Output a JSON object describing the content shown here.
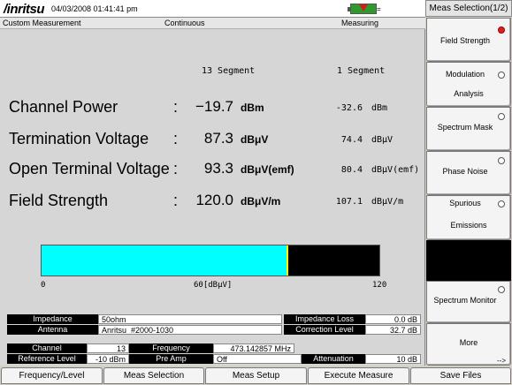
{
  "header": {
    "brand": "/inritsu",
    "datetime": "04/03/2008 01:41:41 pm",
    "battery_suffix": "="
  },
  "status": {
    "mode": "Custom Measurement",
    "sweep": "Continuous",
    "state": "Measuring"
  },
  "segments": {
    "multi": "13 Segment",
    "single": "1 Segment"
  },
  "measurements": [
    {
      "label": "Channel Power",
      "colon": ":",
      "value": "−19.7",
      "unit": "dBm",
      "single_value": "-32.6",
      "single_unit": "dBm"
    },
    {
      "label": "Termination Voltage",
      "colon": ":",
      "value": "87.3",
      "unit": "dBμV",
      "single_value": "74.4",
      "single_unit": "dBμV"
    },
    {
      "label": "Open Terminal Voltage",
      "colon": ":",
      "value": "93.3",
      "unit": "dBμV(emf)",
      "single_value": "80.4",
      "single_unit": "dBμV(emf)"
    },
    {
      "label": "Field Strength",
      "colon": ":",
      "value": "120.0",
      "unit": "dBμV/m",
      "single_value": "107.1",
      "single_unit": "dBμV/m"
    }
  ],
  "bar": {
    "min_label": "0",
    "mid_label": "60[dBμV]",
    "max_label": "120",
    "min": 0,
    "max": 120,
    "value": 87.3,
    "fill_color": "#00ffff",
    "marker_color": "#ffff00"
  },
  "info": {
    "impedance_label": "Impedance",
    "impedance_value": "50ohm",
    "impedance_loss_label": "Impedance Loss",
    "impedance_loss_value": "0.0 dB",
    "antenna_label": "Antenna",
    "antenna_value": "Anritsu_#2000-1030",
    "correction_label": "Correction Level",
    "correction_value": "32.7 dB",
    "channel_label": "Channel",
    "channel_value": "13",
    "frequency_label": "Frequency",
    "frequency_value": "473.142857 MHz",
    "reflevel_label": "Reference Level",
    "reflevel_value": "-10 dBm",
    "preamp_label": "Pre Amp",
    "preamp_value": "Off",
    "attenuation_label": "Attenuation",
    "attenuation_value": "10 dB"
  },
  "menu": {
    "title": "Meas Selection(1/2)",
    "items": [
      {
        "label": "Field Strength",
        "selected": true
      },
      {
        "label": "Modulation",
        "label2": "Analysis",
        "selected": false
      },
      {
        "label": "Spectrum Mask",
        "selected": false
      },
      {
        "label": "Phase Noise",
        "selected": false
      },
      {
        "label": "Spurious",
        "label2": "Emissions",
        "selected": false
      },
      {
        "label": "Spectrum Monitor",
        "selected": false
      },
      {
        "label": "More",
        "more_arrow": "-->"
      }
    ]
  },
  "bottom_keys": [
    "Frequency/Level",
    "Meas Selection",
    "Meas Setup",
    "Execute Measure",
    "Save Files"
  ]
}
